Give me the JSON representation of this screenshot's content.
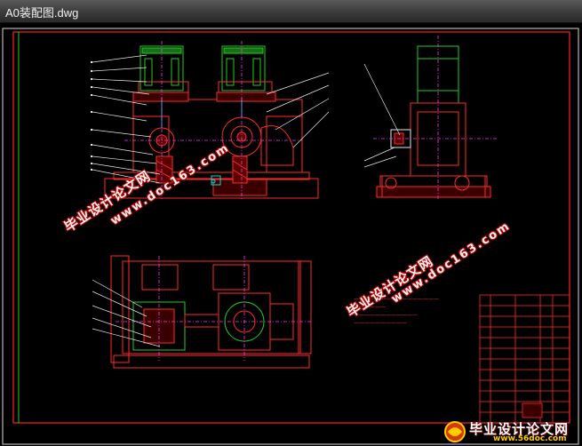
{
  "window": {
    "title": "A0装配图.dwg"
  },
  "colors": {
    "drawing_bg": "#000000",
    "frame": "#ff2020",
    "outer_frame": "#e8e8e8",
    "part": "#ff2a2a",
    "green_part": "#22cc22",
    "cyan_part": "#00dddd",
    "magenta_center": "#ff33ff"
  },
  "watermarks": [
    {
      "cn": "毕业设计论文网",
      "url": "www.doc163.com"
    },
    {
      "cn": "毕业设计论文网",
      "url": "www.doc163.com"
    }
  ],
  "footer": {
    "site_name": "毕业设计论文网",
    "site_url": "www.56doc.com"
  }
}
